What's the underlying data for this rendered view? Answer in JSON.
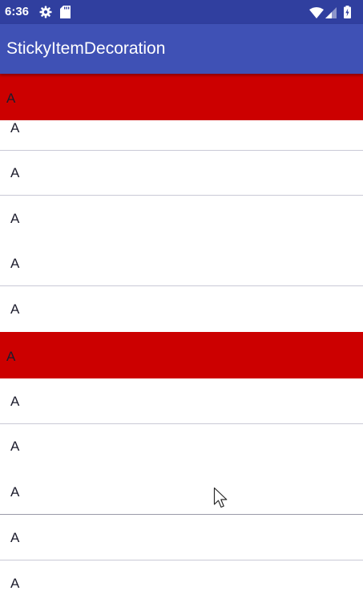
{
  "status_bar": {
    "time": "6:36",
    "color": "#303f9f",
    "icons": [
      "gear-icon",
      "sd-card-icon",
      "wifi-icon",
      "signal-icon",
      "battery-icon"
    ]
  },
  "app_bar": {
    "title": "StickyItemDecoration",
    "color": "#3f51b5"
  },
  "list": {
    "header_color": "#cc0000",
    "sticky_header_label": "A",
    "items": [
      {
        "label": "A"
      },
      {
        "label": "A"
      },
      {
        "label": "A"
      },
      {
        "label": "A"
      },
      {
        "label": "A"
      },
      {
        "label": "A",
        "type": "header"
      },
      {
        "label": "A"
      },
      {
        "label": "A"
      },
      {
        "label": "A"
      },
      {
        "label": "A"
      },
      {
        "label": "A"
      }
    ]
  },
  "cursor": "arrow-cursor-icon"
}
